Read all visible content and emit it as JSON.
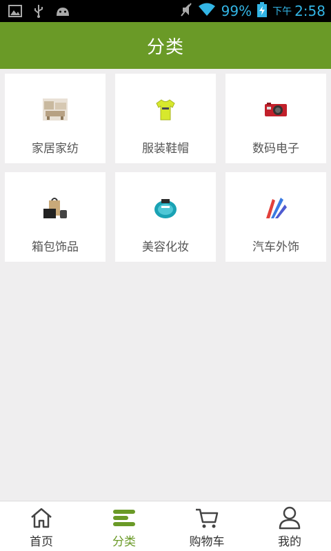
{
  "status_bar": {
    "battery_pct": "99%",
    "ampm": "下午",
    "time": "2:58",
    "icons": [
      "image-icon",
      "usb-icon",
      "android-icon",
      "mute-icon",
      "wifi-icon",
      "battery-charging-icon"
    ]
  },
  "header": {
    "title": "分类"
  },
  "categories": [
    {
      "label": "家居家纺",
      "icon": "home-textile-icon"
    },
    {
      "label": "服装鞋帽",
      "icon": "tshirt-icon"
    },
    {
      "label": "数码电子",
      "icon": "camera-icon"
    },
    {
      "label": "箱包饰品",
      "icon": "bags-icon"
    },
    {
      "label": "美容化妆",
      "icon": "perfume-icon"
    },
    {
      "label": "汽车外饰",
      "icon": "car-decoration-icon"
    }
  ],
  "tabs": [
    {
      "label": "首页",
      "icon": "home-icon",
      "active": false
    },
    {
      "label": "分类",
      "icon": "category-icon",
      "active": true
    },
    {
      "label": "购物车",
      "icon": "cart-icon",
      "active": false
    },
    {
      "label": "我的",
      "icon": "user-icon",
      "active": false
    }
  ],
  "colors": {
    "accent": "#6a9a27",
    "status_blue": "#33b5e5"
  }
}
